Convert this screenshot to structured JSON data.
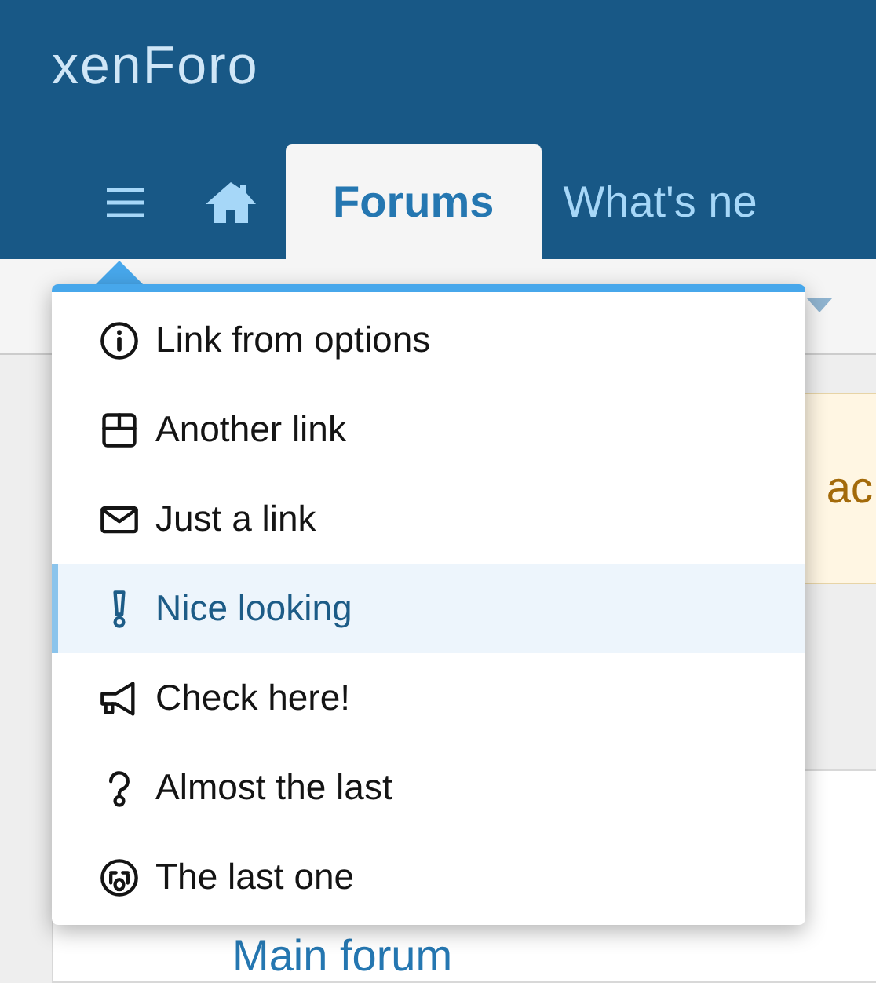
{
  "header": {
    "logo": "xenForo"
  },
  "nav": {
    "tabs": [
      {
        "label": "Forums",
        "selected": true
      },
      {
        "label": "What's ne",
        "selected": false
      }
    ]
  },
  "notice": {
    "text": "ac"
  },
  "forum": {
    "title": "Main forum"
  },
  "menu": {
    "items": [
      {
        "label": "Link from options",
        "selected": false
      },
      {
        "label": "Another link",
        "selected": false
      },
      {
        "label": "Just a link",
        "selected": false
      },
      {
        "label": "Nice looking",
        "selected": true
      },
      {
        "label": "Check here!",
        "selected": false
      },
      {
        "label": "Almost the last",
        "selected": false
      },
      {
        "label": "The last one",
        "selected": false
      }
    ]
  }
}
